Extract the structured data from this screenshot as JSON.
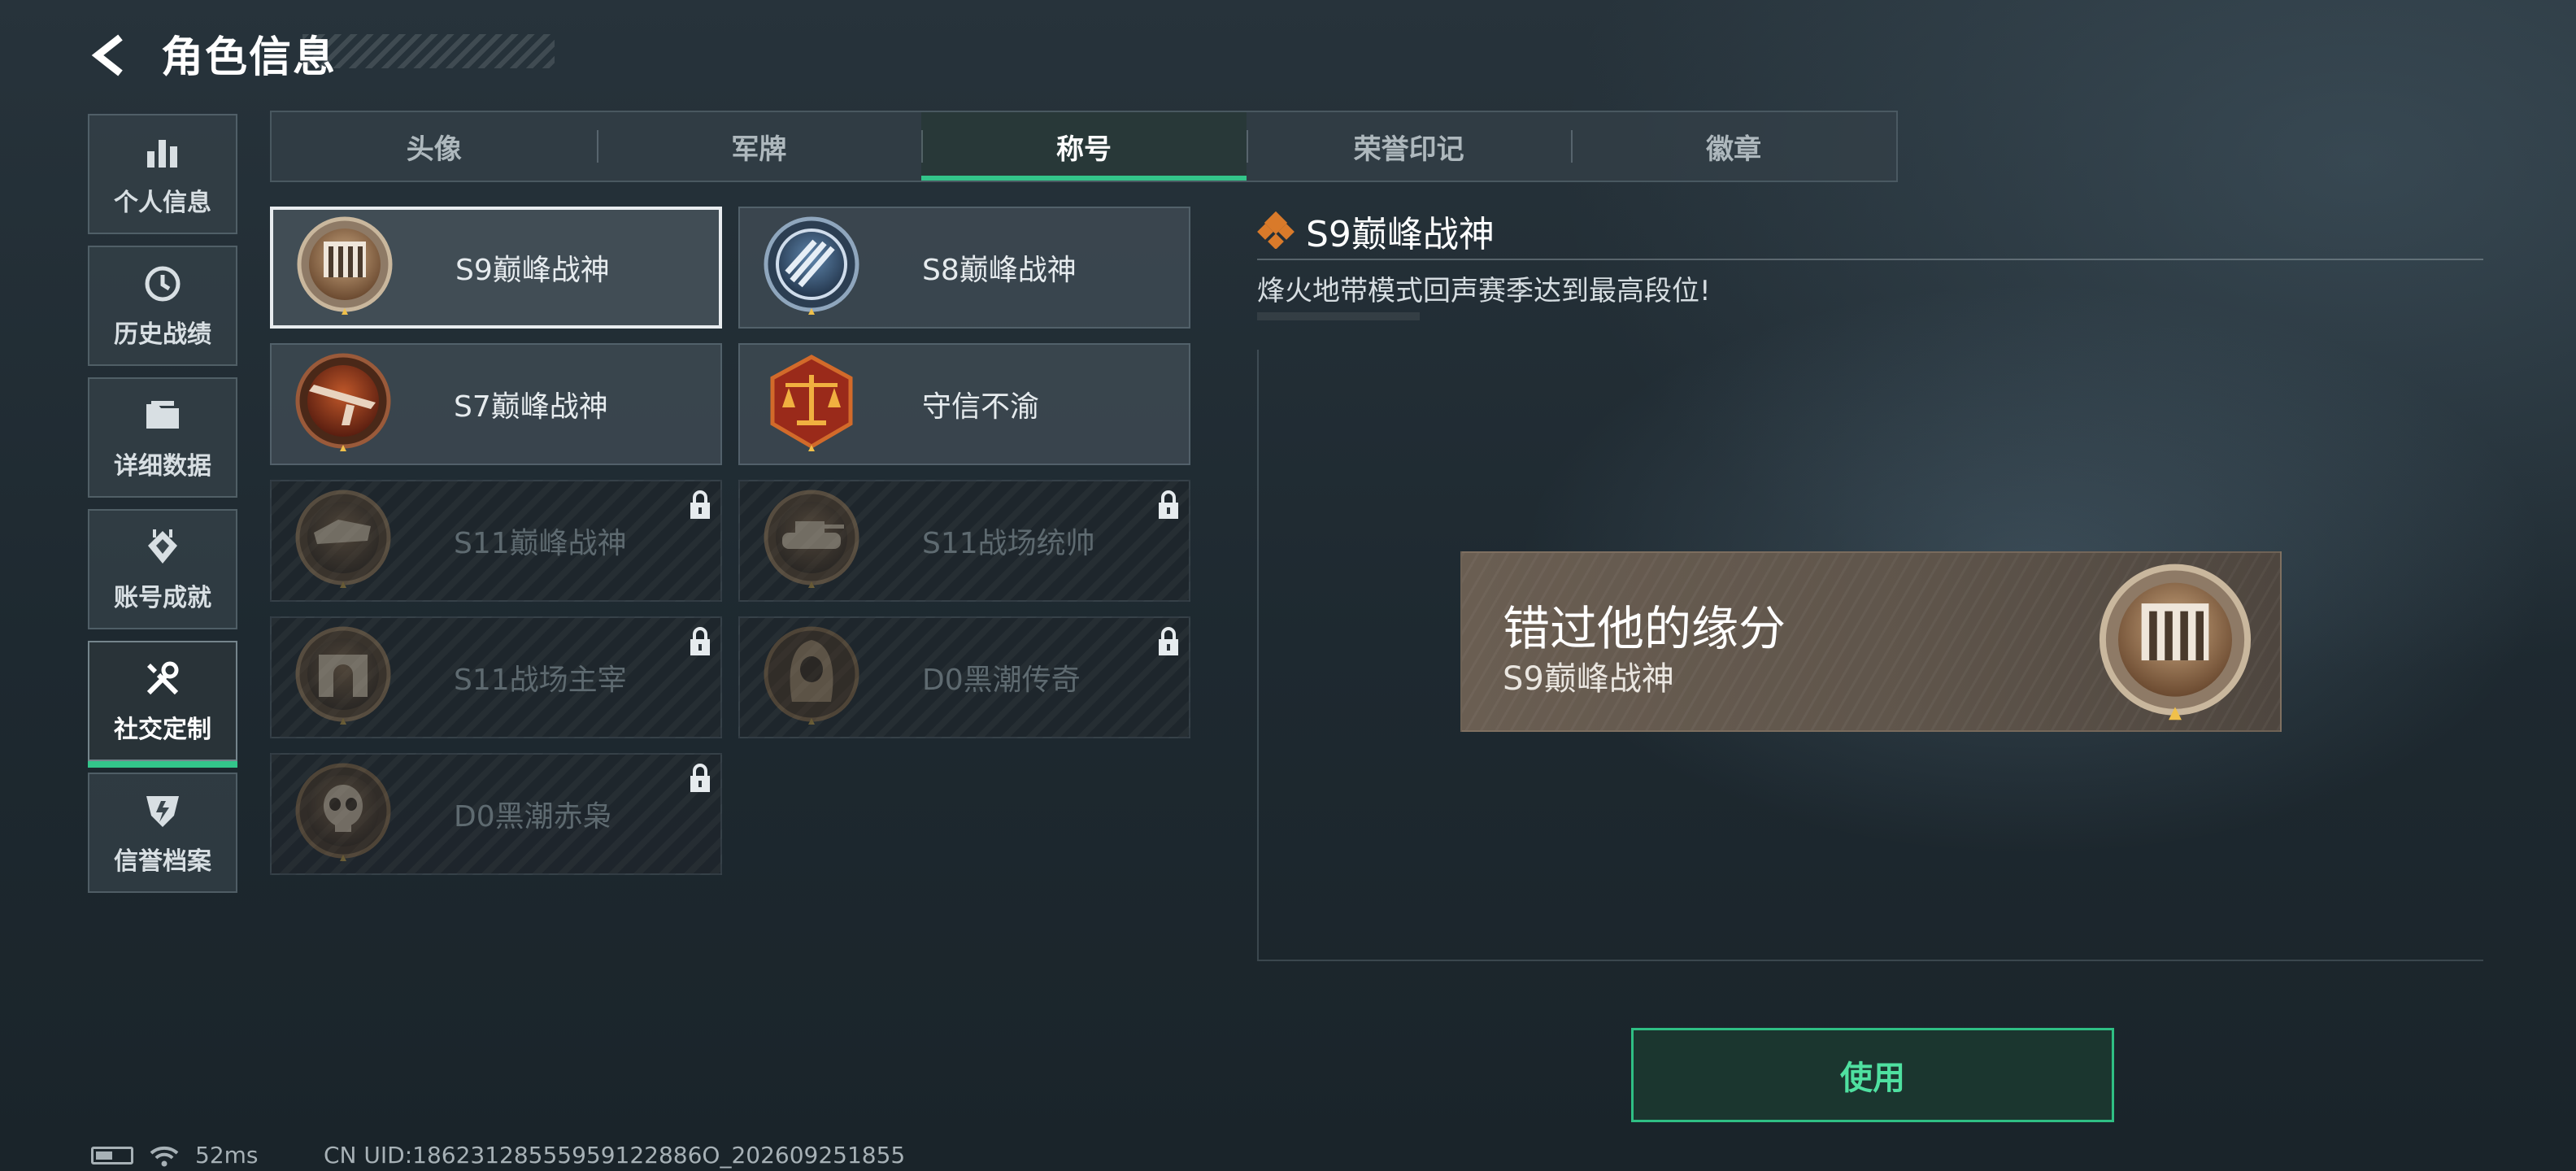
{
  "header": {
    "title": "角色信息"
  },
  "nav": [
    {
      "label": "个人信息",
      "icon": "bar-chart-icon"
    },
    {
      "label": "历史战绩",
      "icon": "history-clock-icon"
    },
    {
      "label": "详细数据",
      "icon": "folder-icon"
    },
    {
      "label": "账号成就",
      "icon": "achievement-icon"
    },
    {
      "label": "社交定制",
      "icon": "tools-icon",
      "active": true
    },
    {
      "label": "信誉档案",
      "icon": "credit-shield-icon"
    }
  ],
  "tabs": [
    {
      "label": "头像"
    },
    {
      "label": "军牌"
    },
    {
      "label": "称号",
      "active": true
    },
    {
      "label": "荣誉印记"
    },
    {
      "label": "徽章"
    }
  ],
  "titles": [
    {
      "name": "S9巅峰战神",
      "emblem": "fortress-emblem",
      "locked": false,
      "selected": true
    },
    {
      "name": "S8巅峰战神",
      "emblem": "blue-crest-emblem",
      "locked": false
    },
    {
      "name": "S7巅峰战神",
      "emblem": "rifle-emblem",
      "locked": false
    },
    {
      "name": "守信不渝",
      "emblem": "scales-emblem",
      "locked": false
    },
    {
      "name": "S11巅峰战神",
      "emblem": "cliff-emblem",
      "locked": true
    },
    {
      "name": "S11战场统帅",
      "emblem": "tank-emblem",
      "locked": true
    },
    {
      "name": "S11战场主宰",
      "emblem": "arch-emblem",
      "locked": true
    },
    {
      "name": "D0黑潮传奇",
      "emblem": "hooded-emblem",
      "locked": true
    },
    {
      "name": "D0黑潮赤枭",
      "emblem": "skull-emblem",
      "locked": true
    }
  ],
  "detail": {
    "title": "S9巅峰战神",
    "description": "烽火地带模式回声赛季达到最高段位!",
    "preview": {
      "player_name": "错过他的缘分",
      "title": "S9巅峰战神"
    }
  },
  "use_button": "使用",
  "status": {
    "ping": "52ms",
    "uid": "CN UID:18623128555959122886O_202609251855"
  },
  "colors": {
    "accent": "#33c58a",
    "button_text": "#4fe0a0"
  }
}
